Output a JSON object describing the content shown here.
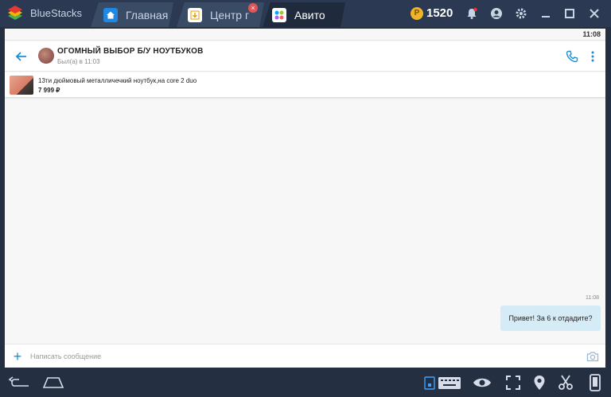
{
  "window": {
    "brand": "BlueStacks",
    "tabs": [
      {
        "label": "Главная",
        "icon": "home-icon"
      },
      {
        "label": "Центр г",
        "icon": "app-center-icon"
      },
      {
        "label": "Авито",
        "icon": "avito-icon"
      }
    ],
    "coins": "1520"
  },
  "status_bar": {
    "time": "11:08"
  },
  "chat": {
    "title": "ОГОМНЫЙ ВЫБОР Б/У НОУТБУКОВ",
    "subtitle": "Был(а) в 11:03"
  },
  "listing": {
    "title": "13ти дюймовый металличечкий ноутбук,на core 2 duo",
    "price": "7 999 ₽"
  },
  "messages": [
    {
      "time": "11:08",
      "text": "Привет! За 6 к отдадите?"
    }
  ],
  "composer": {
    "placeholder": "Написать сообщение"
  },
  "colors": {
    "accent": "#1a8fd9",
    "bubble": "#d5ecf7",
    "frame": "#2b3a52"
  }
}
